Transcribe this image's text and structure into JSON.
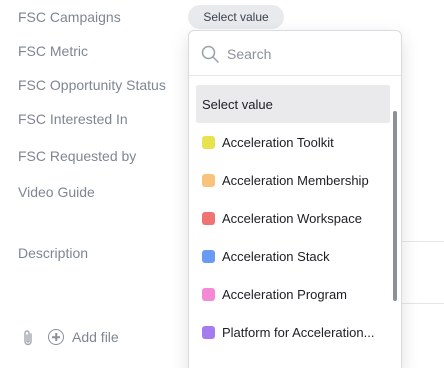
{
  "fields": [
    {
      "label": "FSC Campaigns"
    },
    {
      "label": "FSC Metric"
    },
    {
      "label": "FSC Opportunity Status"
    },
    {
      "label": "FSC Interested In"
    },
    {
      "label": "FSC Requested by"
    },
    {
      "label": "Video Guide"
    },
    {
      "label": "Description"
    }
  ],
  "campaigns_select": {
    "value": "Select value"
  },
  "attachments": {
    "add_file_label": "Add file"
  },
  "dropdown": {
    "search_placeholder": "Search",
    "options": [
      {
        "label": "Select value",
        "selected": true,
        "color": null
      },
      {
        "label": "Acceleration Toolkit",
        "color": "#e6e34f"
      },
      {
        "label": "Acceleration Membership",
        "color": "#f9c37d"
      },
      {
        "label": "Acceleration Workspace",
        "color": "#f07373"
      },
      {
        "label": "Acceleration Stack",
        "color": "#6a9bf4"
      },
      {
        "label": "Acceleration Program",
        "color": "#f48ad6"
      },
      {
        "label": "Platform for Acceleration...",
        "color": "#a47cf0"
      }
    ]
  }
}
